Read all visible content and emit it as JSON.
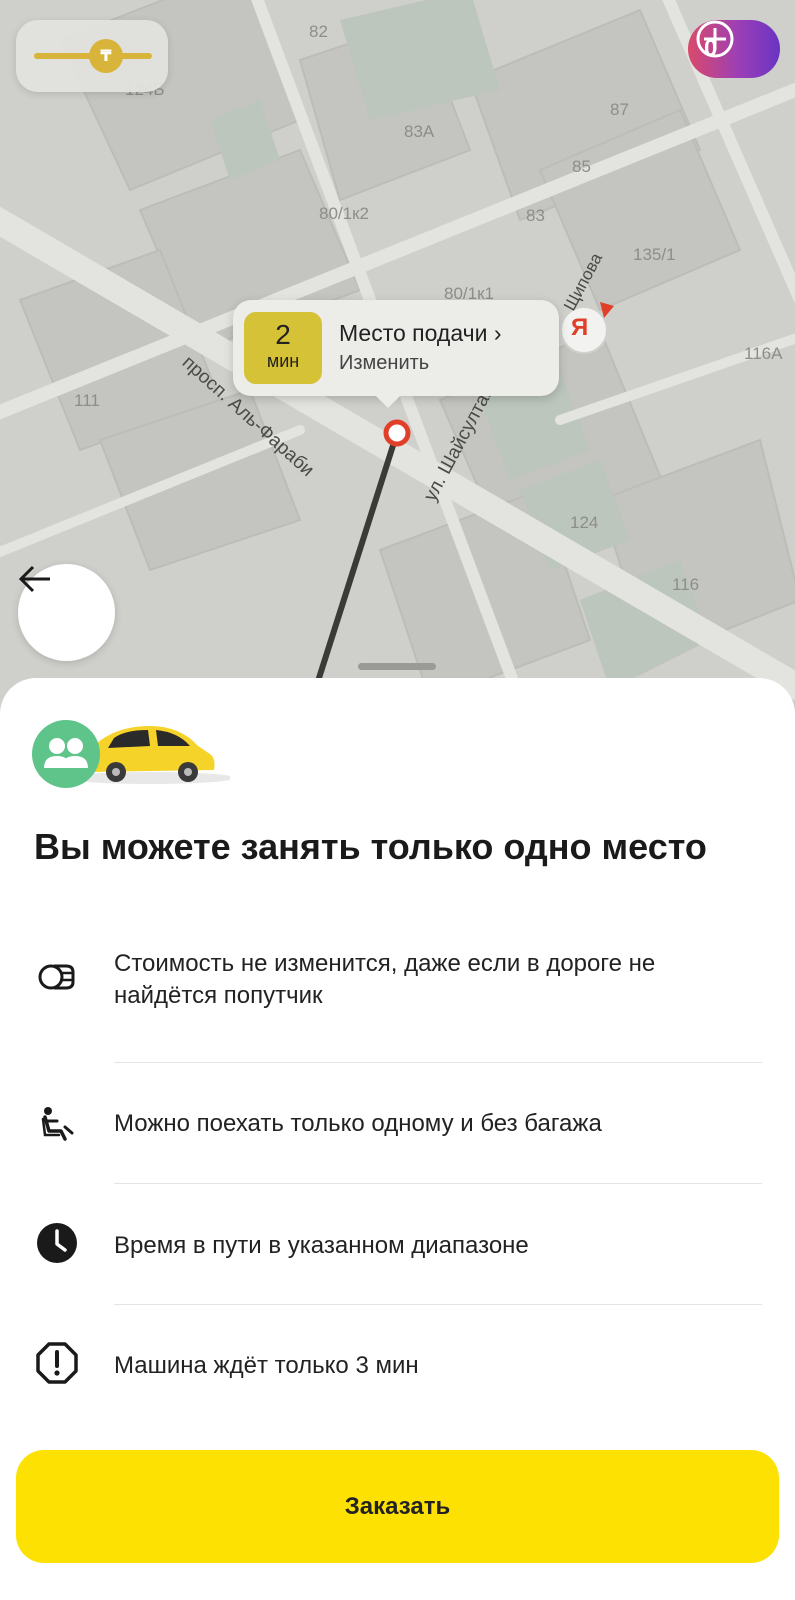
{
  "map": {
    "building_numbers": [
      "82",
      "124Б",
      "83А",
      "87",
      "85",
      "80/1к2",
      "83",
      "135/1",
      "80/1к1",
      "116А",
      "111",
      "124",
      "116"
    ],
    "streets": [
      "просп. Аль-Фараби",
      "ул. Шайсултана",
      "Щипова"
    ],
    "tariff_icon": "tenge-lightning-icon",
    "plus": {
      "count": "0",
      "icon": "plus-icon"
    },
    "pickup": {
      "minutes": "2",
      "minutes_unit": "мин",
      "title": "Место подачи",
      "action": "Изменить"
    },
    "yandex_logo": "Я"
  },
  "sheet": {
    "heading": "Вы можете занять только одно место",
    "features": [
      {
        "icon": "coins-icon",
        "text": "Стоимость не изменится, даже если в дороге не найдётся попутчик"
      },
      {
        "icon": "seated-person-icon",
        "text": "Можно поехать только одному и без багажа"
      },
      {
        "icon": "clock-icon",
        "text": "Время в пути в указанном диапазоне"
      },
      {
        "icon": "alert-icon",
        "text": "Машина ждёт только 3 мин"
      }
    ],
    "order_button": "Заказать"
  },
  "colors": {
    "accent": "#fde102",
    "pickup_badge": "#d6c236",
    "route_marker": "#e0402a"
  }
}
